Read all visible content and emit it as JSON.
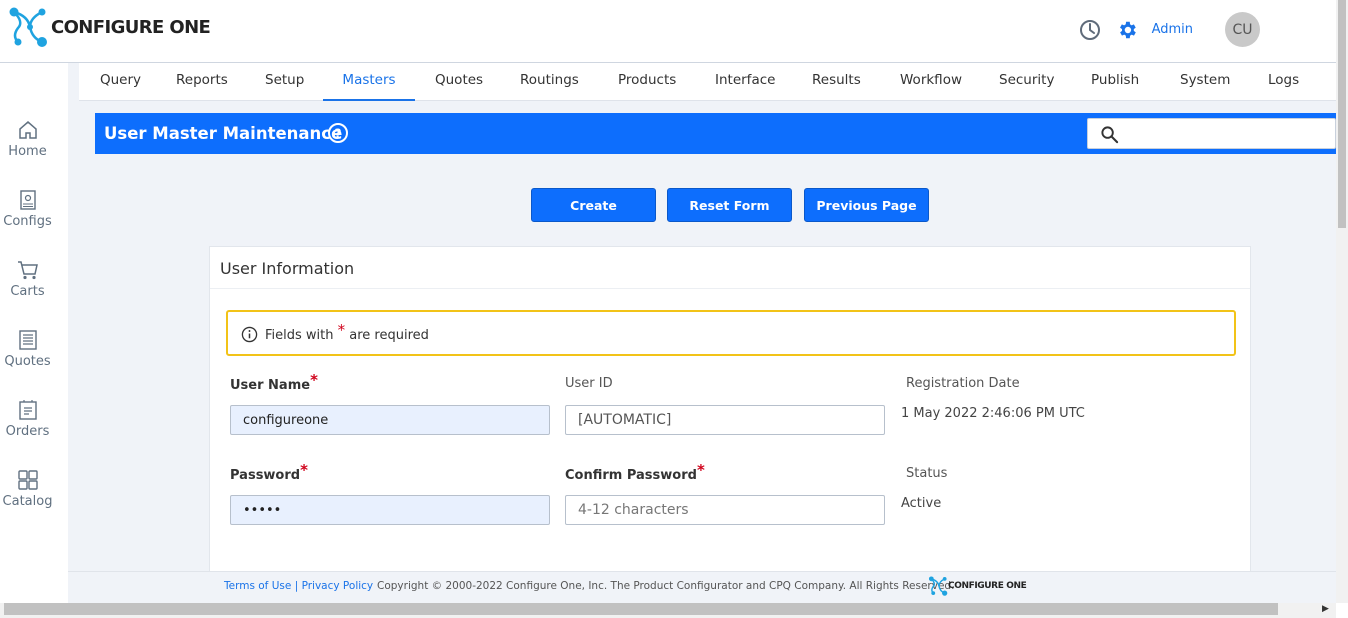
{
  "header": {
    "logo_text": "CONFIGURE ONE",
    "admin_label": "Admin",
    "avatar_initials": "CU"
  },
  "sidenav": {
    "items": [
      {
        "label": "Home",
        "icon": "home-icon"
      },
      {
        "label": "Configs",
        "icon": "configs-icon"
      },
      {
        "label": "Carts",
        "icon": "cart-icon"
      },
      {
        "label": "Quotes",
        "icon": "quotes-icon"
      },
      {
        "label": "Orders",
        "icon": "orders-icon"
      },
      {
        "label": "Catalog",
        "icon": "catalog-icon"
      }
    ]
  },
  "tabs": [
    "Query",
    "Reports",
    "Setup",
    "Masters",
    "Quotes",
    "Routings",
    "Products",
    "Interface",
    "Results",
    "Workflow",
    "Security",
    "Publish",
    "System",
    "Logs"
  ],
  "active_tab": "Masters",
  "page": {
    "title": "User Master Maintenance",
    "search_placeholder": ""
  },
  "buttons": {
    "create": "Create",
    "reset": "Reset Form",
    "previous": "Previous Page"
  },
  "card": {
    "title": "User Information",
    "notice_prefix": "Fields with",
    "notice_star": "*",
    "notice_suffix": "are required"
  },
  "form": {
    "username_label": "User Name",
    "username_value": "configureone",
    "userid_label": "User ID",
    "userid_value": "[AUTOMATIC]",
    "regdate_label": "Registration Date",
    "regdate_value": "1 May 2022 2:46:06 PM UTC",
    "password_label": "Password",
    "password_value": "•••••",
    "confirm_label": "Confirm Password",
    "confirm_placeholder": "4-12 characters",
    "status_label": "Status",
    "status_value": "Active",
    "required_mark": "*"
  },
  "footer": {
    "terms": "Terms of Use",
    "separator": "|",
    "privacy": "Privacy Policy",
    "copyright": "Copyright © 2000-2022 Configure One, Inc. The Product Configurator and CPQ Company. All Rights Reserved.",
    "logo_text": "CONFIGURE ONE"
  },
  "colors": {
    "primary": "#0d6efd",
    "link": "#1a73e8",
    "notice_border": "#f2c318",
    "required": "#d0021b",
    "logo_accent": "#1fa3e0"
  }
}
